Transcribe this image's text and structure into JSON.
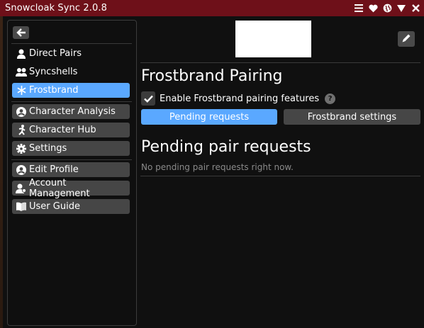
{
  "window": {
    "title": "Snowcloak Sync 2.0.8"
  },
  "titlebar_icons": [
    "menu-icon",
    "heart-icon",
    "globe-icon",
    "collapse-icon",
    "close-icon"
  ],
  "sidebar": {
    "back_icon": "arrow-left-icon",
    "group1": [
      {
        "label": "Direct Pairs",
        "icon": "user-icon",
        "active": false
      },
      {
        "label": "Syncshells",
        "icon": "users-icon",
        "active": false
      },
      {
        "label": "Frostbrand",
        "icon": "snowflake-icon",
        "active": true
      }
    ],
    "group2": [
      {
        "label": "Character Analysis",
        "icon": "user-circle-icon"
      },
      {
        "label": "Character Hub",
        "icon": "running-icon"
      },
      {
        "label": "Settings",
        "icon": "gear-icon"
      }
    ],
    "group3": [
      {
        "label": "Edit Profile",
        "icon": "profile-icon"
      },
      {
        "label": "Account Management",
        "icon": "account-icon"
      },
      {
        "label": "User Guide",
        "icon": "book-icon"
      }
    ]
  },
  "main": {
    "title": "Frostbrand Pairing",
    "enable_label": "Enable Frostbrand pairing features",
    "enable_checked": true,
    "help": "?",
    "tabs": [
      {
        "label": "Pending requests",
        "active": true
      },
      {
        "label": "Frostbrand settings",
        "active": false
      }
    ],
    "section_title": "Pending pair requests",
    "empty_message": "No pending pair requests right now."
  },
  "colors": {
    "titlebar": "#6e1019",
    "accent": "#5aa8ff",
    "button": "#464646",
    "background": "#101010"
  }
}
